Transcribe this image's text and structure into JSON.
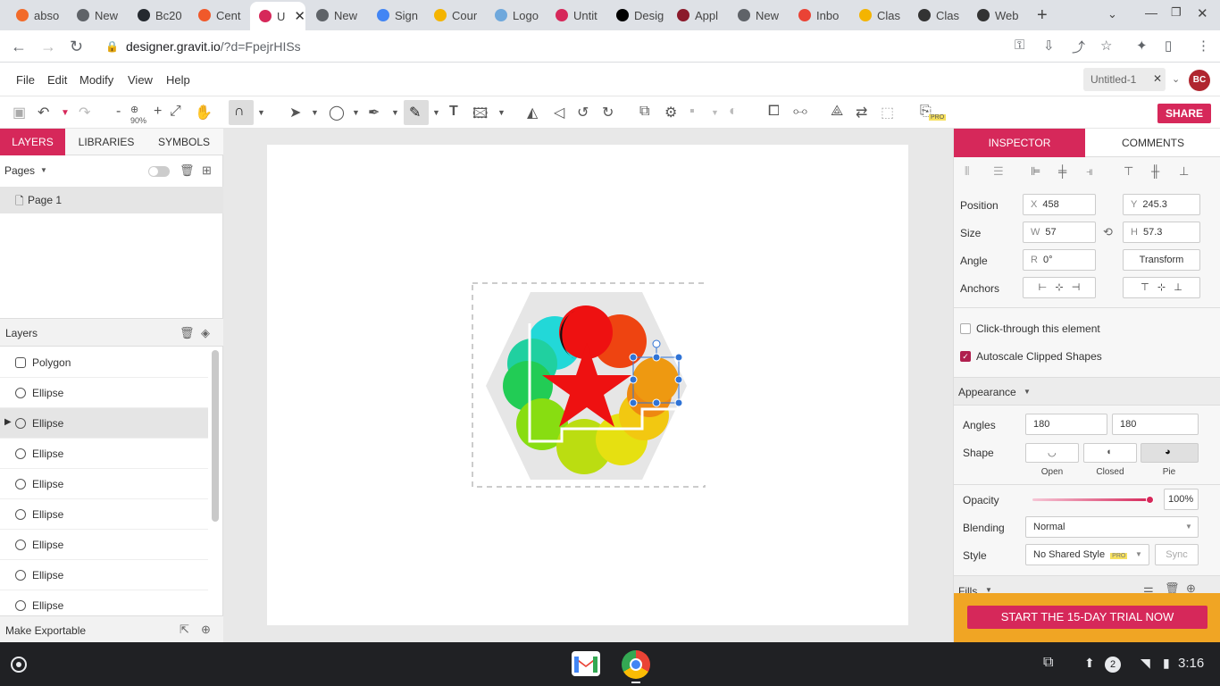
{
  "tabs": [
    {
      "label": "abso",
      "color": "#f26b2a"
    },
    {
      "label": "New",
      "color": "#5f6368"
    },
    {
      "label": "Bc20",
      "color": "#24292f"
    },
    {
      "label": "Cent",
      "color": "#f0592a"
    },
    {
      "label": "U",
      "color": "#d6285a",
      "active": true
    },
    {
      "label": "New",
      "color": "#5f6368"
    },
    {
      "label": "Sign",
      "color": "#4285f4"
    },
    {
      "label": "Cour",
      "color": "#f4b400"
    },
    {
      "label": "Logo",
      "color": "#6fa8dc"
    },
    {
      "label": "Untit",
      "color": "#d6285a"
    },
    {
      "label": "Desig",
      "color": "#000000"
    },
    {
      "label": "Appl",
      "color": "#8b1a2b"
    },
    {
      "label": "New",
      "color": "#5f6368"
    },
    {
      "label": "Inbo",
      "color": "#ea4335"
    },
    {
      "label": "Clas",
      "color": "#f4b400"
    },
    {
      "label": "Clas",
      "color": "#333333"
    },
    {
      "label": "Web",
      "color": "#333333"
    }
  ],
  "address": {
    "host": "designer.gravit.io",
    "path": "/?d=FpejrHISs"
  },
  "menu": [
    "File",
    "Edit",
    "Modify",
    "View",
    "Help"
  ],
  "doc_tab": "Untitled-1",
  "avatar": "BC",
  "share": "SHARE",
  "zoom": "90%",
  "left_tabs": [
    "LAYERS",
    "LIBRARIES",
    "SYMBOLS"
  ],
  "pages_label": "Pages",
  "page_name": "Page 1",
  "layers_label": "Layers",
  "layers": [
    "Polygon",
    "Ellipse",
    "Ellipse",
    "Ellipse",
    "Ellipse",
    "Ellipse",
    "Ellipse",
    "Ellipse",
    "Ellipse"
  ],
  "make_exportable": "Make Exportable",
  "right_tabs": [
    "INSPECTOR",
    "COMMENTS"
  ],
  "inspector": {
    "position_label": "Position",
    "x_pre": "X",
    "x": "458",
    "y_pre": "Y",
    "y": "245.3",
    "size_label": "Size",
    "w_pre": "W",
    "w": "57",
    "h_pre": "H",
    "h": "57.3",
    "angle_label": "Angle",
    "r_pre": "R",
    "angle": "0°",
    "transform": "Transform",
    "anchors_label": "Anchors",
    "click_through": "Click-through this element",
    "autoscale": "Autoscale Clipped Shapes",
    "appearance": "Appearance",
    "angles_label": "Angles",
    "angle1": "180",
    "angle2": "180",
    "shape_label": "Shape",
    "shape_open": "Open",
    "shape_closed": "Closed",
    "shape_pie": "Pie",
    "opacity_label": "Opacity",
    "opacity": "100%",
    "blending_label": "Blending",
    "blending": "Normal",
    "style_label": "Style",
    "style": "No Shared Style",
    "pro": "PRO",
    "sync": "Sync",
    "fills_label": "Fills"
  },
  "trial": "START THE 15-DAY TRIAL NOW",
  "shelf": {
    "time": "3:16",
    "notif": "2"
  },
  "colors": {
    "accent": "#d6285a",
    "trial_bg": "#f0a524"
  }
}
